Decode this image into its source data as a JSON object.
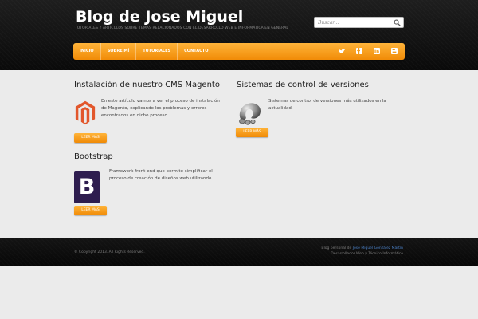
{
  "header": {
    "title": "Blog de Jose Miguel",
    "tagline": "TUTORIALES Y ARTÍCULOS SOBRE TEMAS RELACIONADOS CON EL DESARROLLO WEB E INFORMÁTICA EN GENERAL",
    "search_placeholder": "Buscar..."
  },
  "nav": {
    "items": [
      {
        "label": "INICIO"
      },
      {
        "label": "SOBRE MÍ"
      },
      {
        "label": "TUTORIALES"
      },
      {
        "label": "CONTACTO"
      }
    ],
    "social_icons": [
      "twitter-icon",
      "facebook-icon",
      "linkedin-icon",
      "blogger-icon"
    ]
  },
  "posts": [
    {
      "title": "Instalación de nuestro CMS Magento",
      "excerpt": "En este artículo vamos a ver el proceso de instalación de Magento, explicando los problemas y errores encontrados en dicho proceso.",
      "button": "LEER MÁS",
      "icon": "magento-logo-icon"
    },
    {
      "title": "Sistemas de control de versiones",
      "excerpt": "Sistemas de control de versiones más utilizados en la actualidad.",
      "button": "LEER MÁS",
      "icon": "version-control-logo-icon"
    },
    {
      "title": "Bootstrap",
      "excerpt": "Framework front-end que permite simplificar el proceso de creación de diseños web utilizando...",
      "button": "LEER MÁS",
      "icon": "bootstrap-logo-icon",
      "logo_letter": "B"
    }
  ],
  "footer": {
    "copyright": "© Copyright 2013. All Rights Reserved.",
    "credit_prefix": "Blog personal de ",
    "credit_name": "José Miguel González Martín",
    "credit_role": "Desarrollador Web y Técnico Informático"
  },
  "colors": {
    "accent": "#f7a21d",
    "header_bg": "#141414",
    "content_bg": "#ebebeb",
    "link": "#4a7fc4",
    "magento": "#e2572c",
    "bootstrap": "#2e1d4f"
  }
}
